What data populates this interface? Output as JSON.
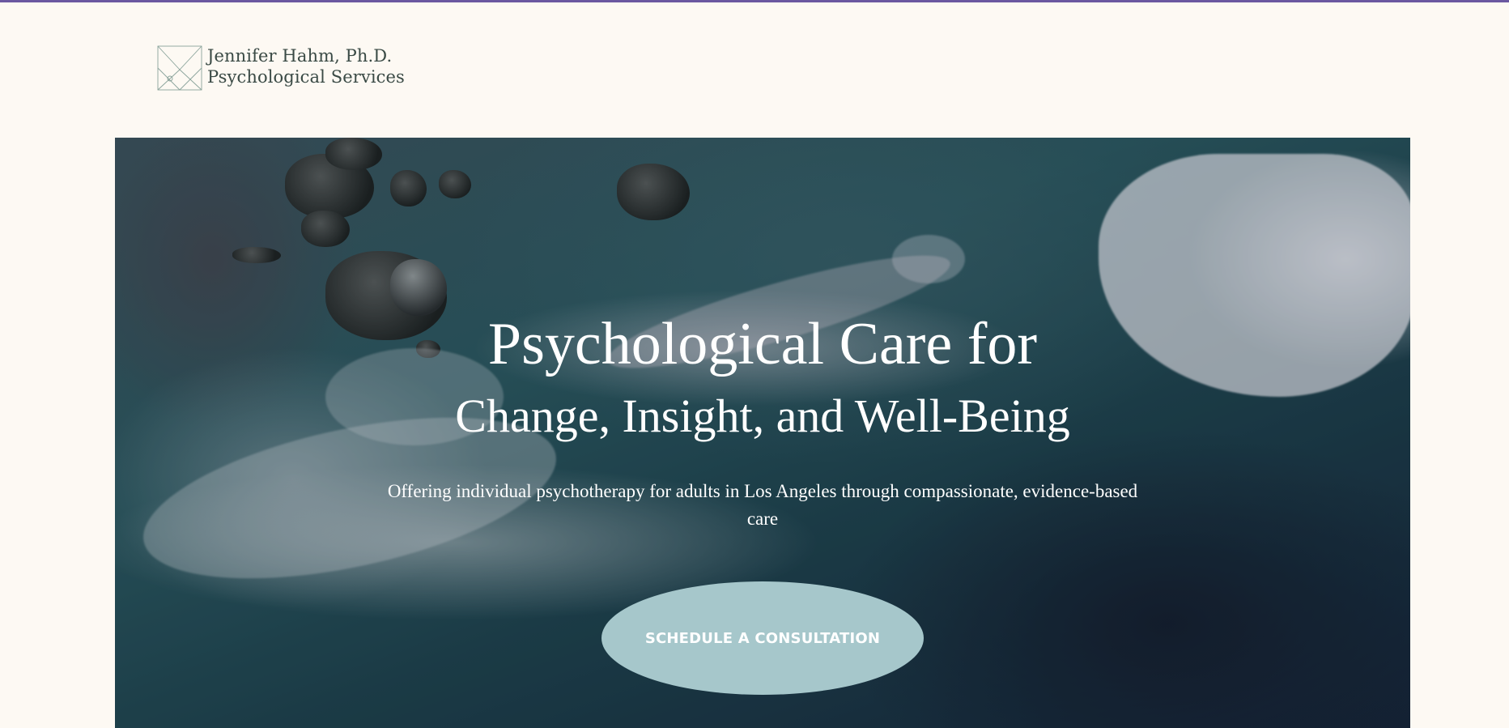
{
  "brand": {
    "line1": "Jennifer Hahm, Ph.D.",
    "line2": "Psychological Services",
    "logo_icon": "geometric-envelope-logo-icon"
  },
  "hero": {
    "title_line1": "Psychological Care for",
    "title_line2": "Change, Insight, and Well-Being",
    "subtitle": "Offering individual psychotherapy for adults in Los Angeles through compassionate, evidence-based care",
    "cta_label": "SCHEDULE A CONSULTATION",
    "background_image": "aerial ocean waves crashing on rocky shore"
  },
  "colors": {
    "top_bar": "#6b58a0",
    "page_background": "#fdf9f3",
    "brand_text": "#3a4a45",
    "cta_background": "#a6c7cb",
    "hero_text": "#ffffff"
  }
}
